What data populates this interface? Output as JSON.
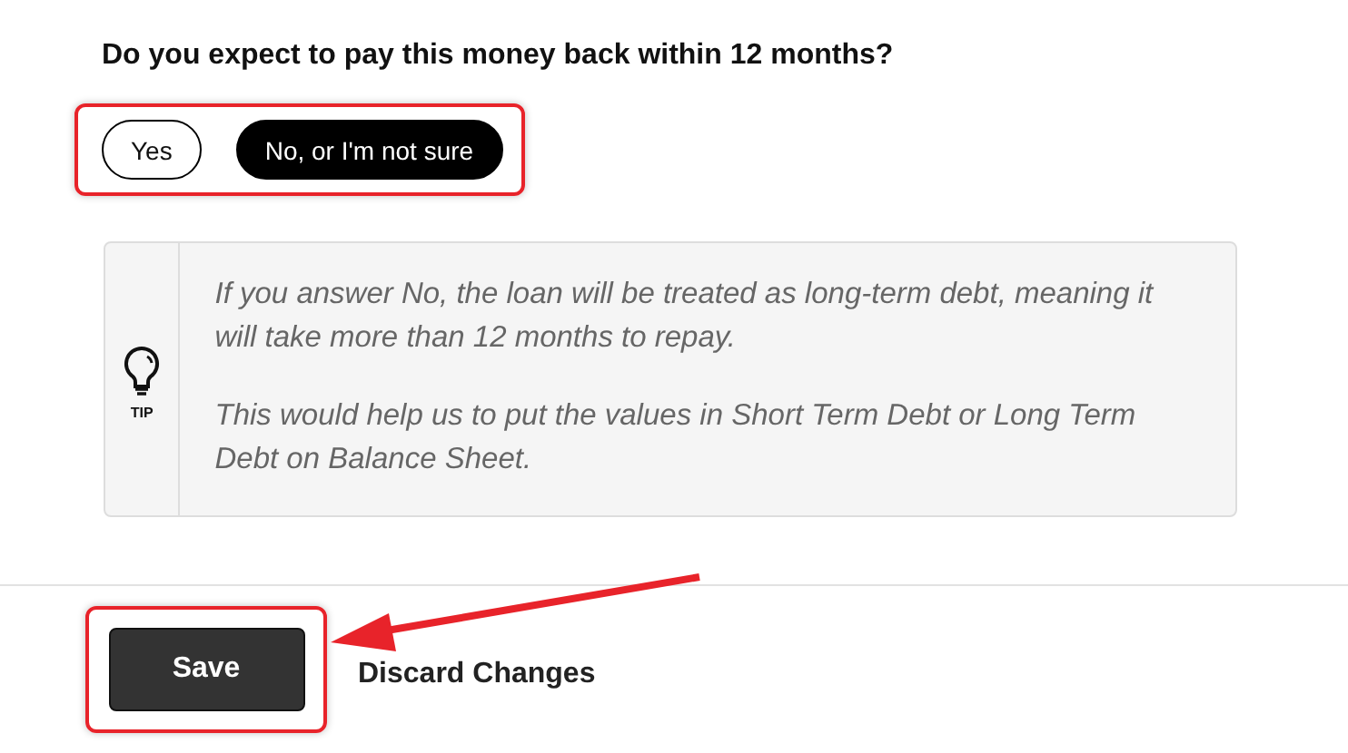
{
  "question": "Do you expect to pay this money back within 12 months?",
  "options": [
    {
      "label": "Yes",
      "selected": false
    },
    {
      "label": "No, or I'm not sure",
      "selected": true
    }
  ],
  "tip": {
    "label": "TIP",
    "paragraphs": [
      "If you answer No, the loan will be treated as long-term debt, meaning it will take more than 12 months to repay.",
      "This would help us to put the values in Short Term Debt or Long Term Debt on Balance Sheet."
    ]
  },
  "actions": {
    "save": "Save",
    "discard": "Discard Changes"
  }
}
